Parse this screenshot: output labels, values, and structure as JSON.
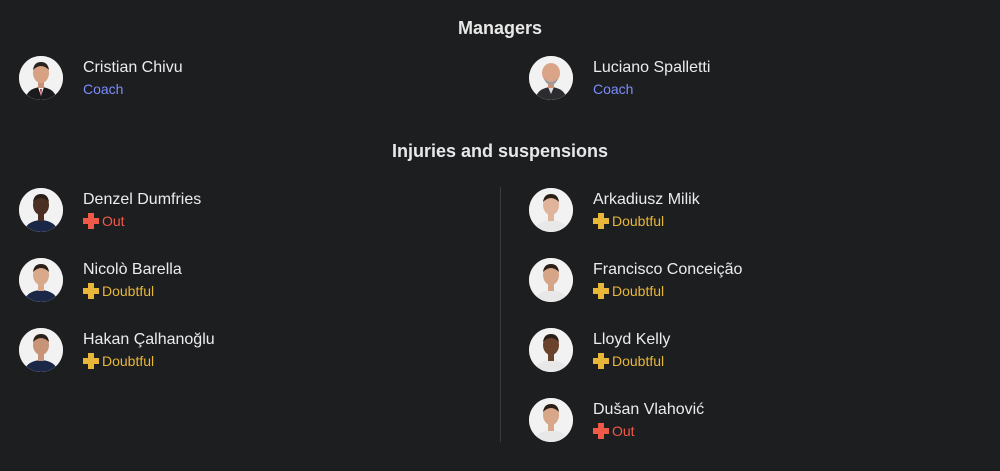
{
  "managers": {
    "title": "Managers",
    "home": {
      "name": "Cristian Chivu",
      "role": "Coach",
      "avatar": "manager-photo"
    },
    "away": {
      "name": "Luciano Spalletti",
      "role": "Coach",
      "avatar": "manager-photo"
    }
  },
  "injuries": {
    "title": "Injuries and suspensions",
    "home": [
      {
        "name": "Denzel Dumfries",
        "status": "Out",
        "status_type": "out",
        "skin": "#4a2f22",
        "kit": "#1a2746"
      },
      {
        "name": "Nicolò Barella",
        "status": "Doubtful",
        "status_type": "doubtful",
        "skin": "#d9a98b",
        "kit": "#1a2746"
      },
      {
        "name": "Hakan Çalhanoğlu",
        "status": "Doubtful",
        "status_type": "doubtful",
        "skin": "#c79477",
        "kit": "#1a2746"
      }
    ],
    "away": [
      {
        "name": "Arkadiusz Milik",
        "status": "Doubtful",
        "status_type": "doubtful",
        "skin": "#e0b49a",
        "kit": "#e8e8e8"
      },
      {
        "name": "Francisco Conceição",
        "status": "Doubtful",
        "status_type": "doubtful",
        "skin": "#d6a587",
        "kit": "#e8e8e8"
      },
      {
        "name": "Lloyd Kelly",
        "status": "Doubtful",
        "status_type": "doubtful",
        "skin": "#6b432c",
        "kit": "#e8e8e8"
      },
      {
        "name": "Dušan Vlahović",
        "status": "Out",
        "status_type": "out",
        "skin": "#d8a78a",
        "kit": "#e8e8e8"
      }
    ]
  },
  "colors": {
    "background": "#1d1e20",
    "coach_role": "#7b8cff",
    "status_out": "#ef5a48",
    "status_doubtful": "#e8b73a",
    "divider": "#3a3b3e"
  }
}
